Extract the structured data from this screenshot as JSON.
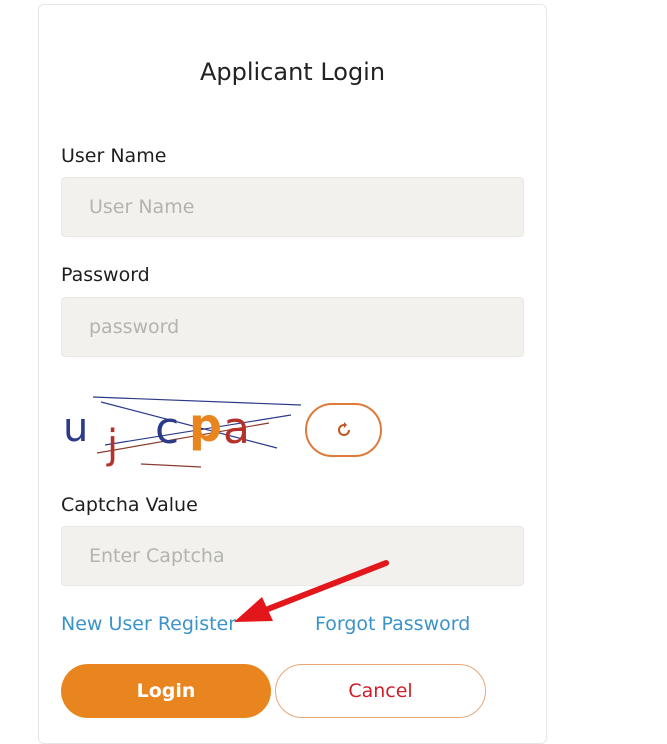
{
  "page": {
    "title": "Applicant Login"
  },
  "form": {
    "username_label": "User Name",
    "username_placeholder": "User Name",
    "password_label": "Password",
    "password_placeholder": "password",
    "captcha_text": "ujcpa",
    "captcha_label": "Captcha Value",
    "captcha_placeholder": "Enter Captcha"
  },
  "links": {
    "register": "New User Register",
    "forgot": "Forgot Password"
  },
  "buttons": {
    "login": "Login",
    "cancel": "Cancel"
  },
  "colors": {
    "accent": "#e8851f",
    "link": "#3a93c9",
    "cancel_text": "#cc1f2c",
    "annotation_arrow": "#e3171b"
  },
  "icons": {
    "refresh": "refresh-icon",
    "arrow": "red-annotation-arrow"
  }
}
